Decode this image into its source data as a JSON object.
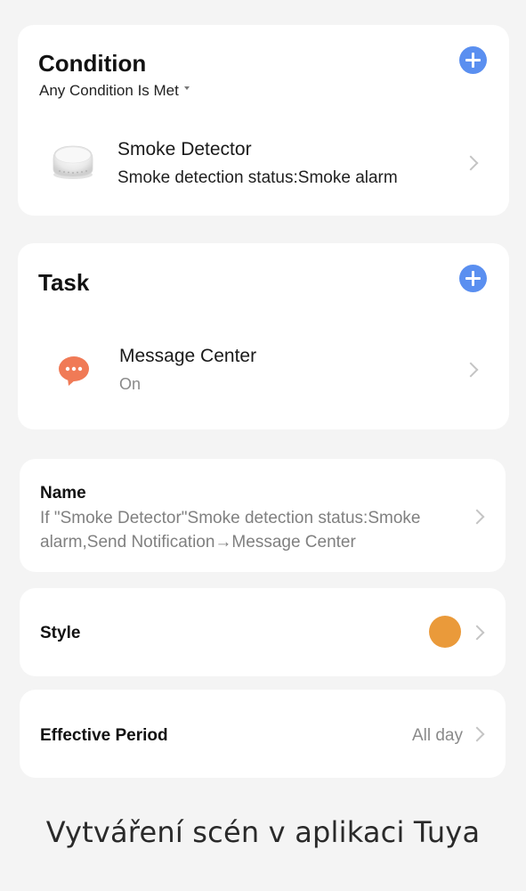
{
  "condition": {
    "title": "Condition",
    "match_mode": "Any Condition Is Met",
    "items": [
      {
        "name": "Smoke Detector",
        "detail": "Smoke detection status:Smoke alarm",
        "icon": "smoke-detector-icon"
      }
    ]
  },
  "task": {
    "title": "Task",
    "items": [
      {
        "name": "Message Center",
        "detail": "On",
        "icon": "message-bubble-icon"
      }
    ]
  },
  "name_setting": {
    "label": "Name",
    "value": "If \"Smoke Detector\"Smoke detection status:Smoke alarm,Send Notification→Message Center"
  },
  "style_setting": {
    "label": "Style",
    "color": "#ea9a3a"
  },
  "period_setting": {
    "label": "Effective Period",
    "value": "All day"
  },
  "caption": "Vytváření scén v aplikaci Tuya",
  "colors": {
    "accent": "#5a8ff0",
    "message_icon": "#f07a56"
  }
}
